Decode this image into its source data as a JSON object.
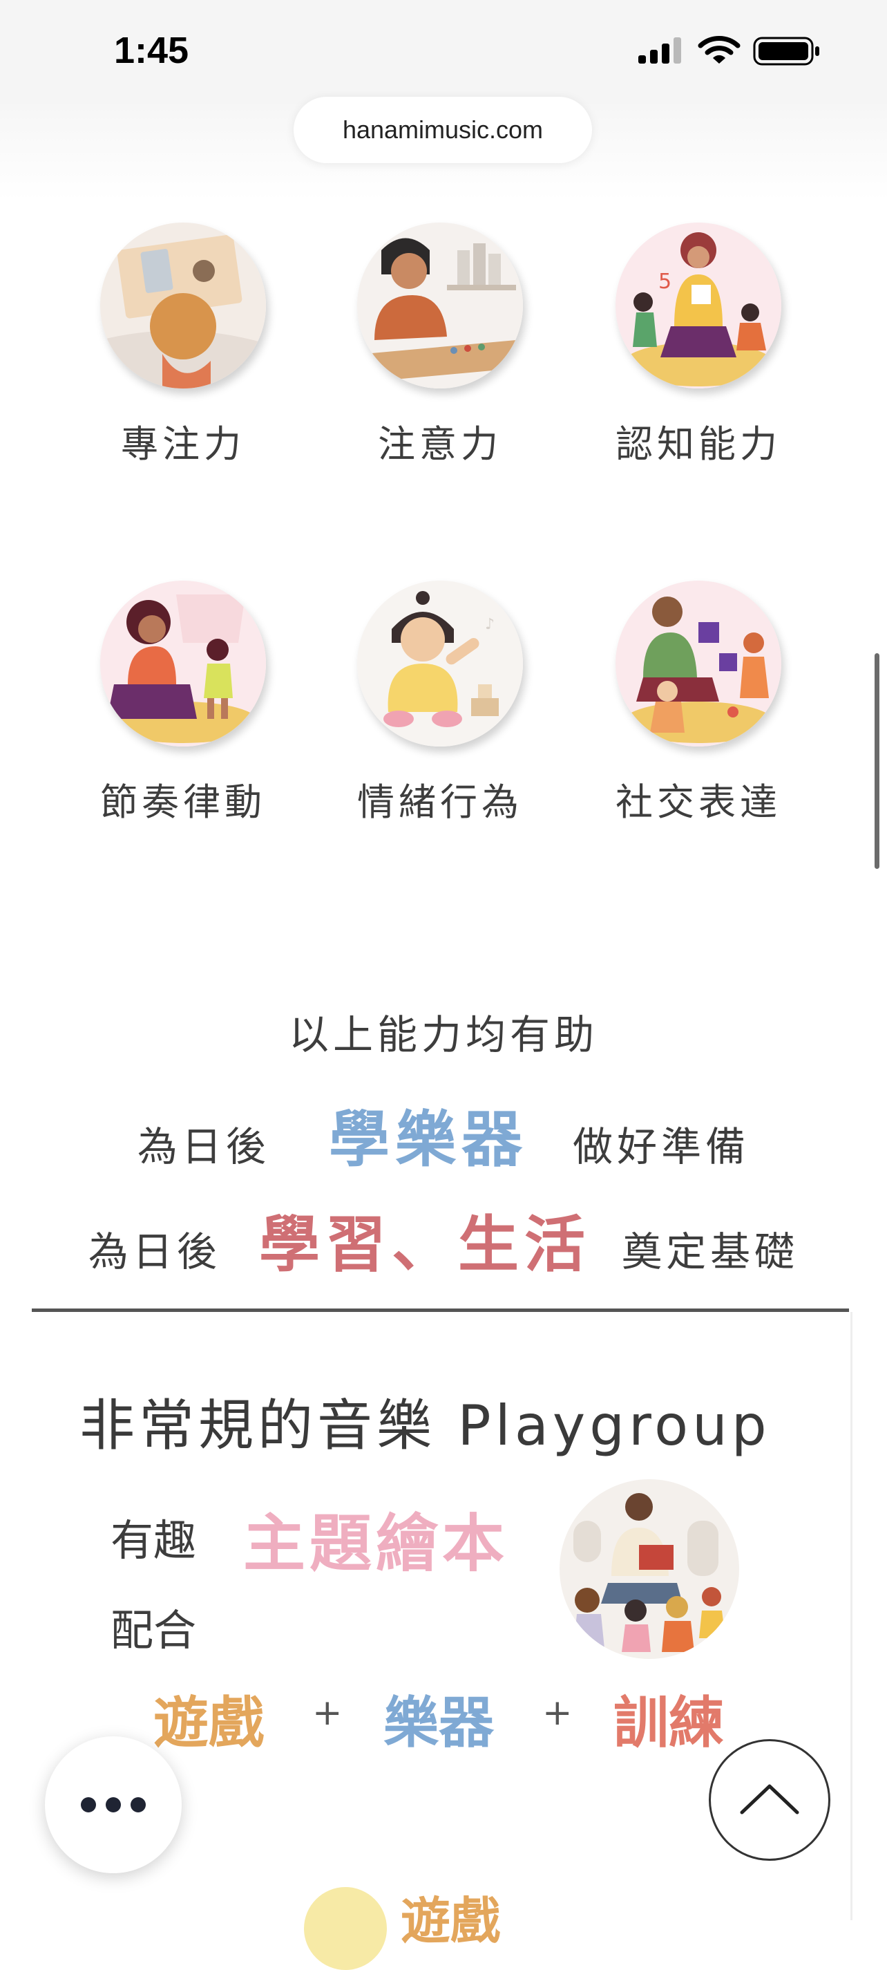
{
  "status_bar": {
    "time": "1:45"
  },
  "browser": {
    "url": "hanamimusic.com"
  },
  "skills": [
    {
      "label": "專注力"
    },
    {
      "label": "注意力"
    },
    {
      "label": "認知能力"
    },
    {
      "label": "節奏律動"
    },
    {
      "label": "情緒行為"
    },
    {
      "label": "社交表達"
    }
  ],
  "summary": {
    "line1": "以上能力均有助",
    "line2_prefix": "為日後",
    "line2_highlight": "學樂器",
    "line2_suffix": "做好準備",
    "line3_prefix": "為日後",
    "line3_highlight": "學習、生活",
    "line3_suffix": "奠定基礎"
  },
  "playgroup": {
    "title": "非常規的音樂 Playgroup",
    "fun": "有趣",
    "theme": "主題繪本",
    "combine": "配合",
    "game": "遊戲",
    "instrument": "樂器",
    "training": "訓練",
    "plus": "+",
    "next_heading": "遊戲"
  },
  "colors": {
    "blue": "#7fa9d4",
    "red": "#cf6f74",
    "pink": "#efaec0",
    "orange": "#e3a65c",
    "peach": "#e27a6a"
  }
}
